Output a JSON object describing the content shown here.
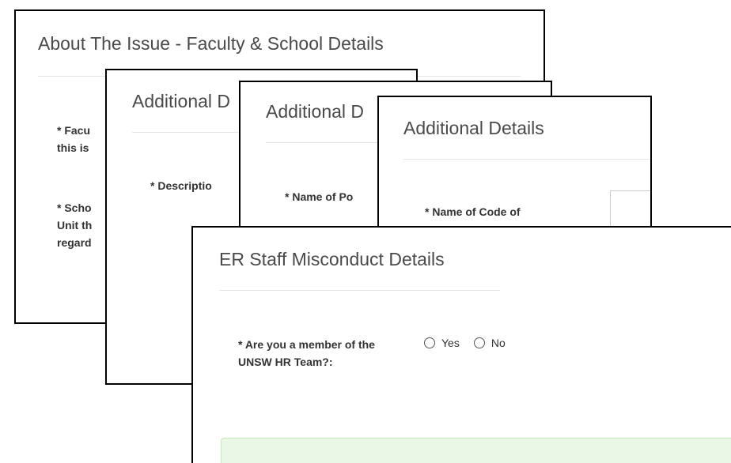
{
  "card_faculty": {
    "title": "About The Issue - Faculty & School Details",
    "faculty_label_line1": "* Facu",
    "faculty_label_line2": "this is",
    "school_label_line1": "* Scho",
    "school_label_line2": "Unit th",
    "school_label_line3": "regard"
  },
  "card_description": {
    "title": "Additional D",
    "description_label": "* Descriptio"
  },
  "card_policy": {
    "title": "Additional D",
    "policy_label": "* Name of Po"
  },
  "card_code": {
    "title": "Additional Details",
    "code_label": "* Name of Code of"
  },
  "card_misconduct": {
    "title": "ER Staff Misconduct Details",
    "question": "* Are you a member of the UNSW HR Team?:",
    "options": [
      "Yes",
      "No"
    ]
  }
}
